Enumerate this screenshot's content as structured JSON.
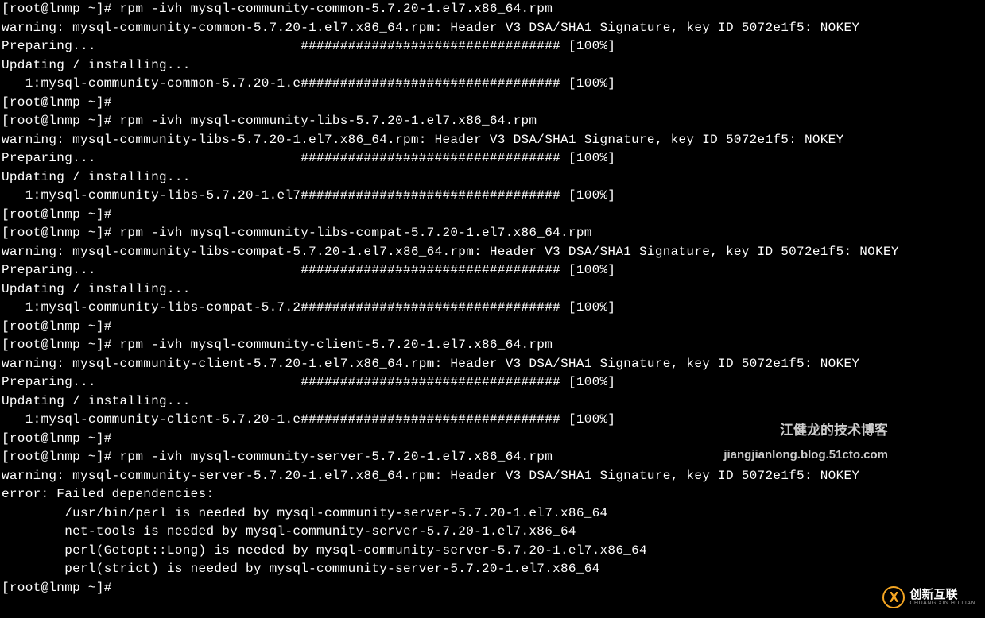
{
  "terminal": {
    "lines": [
      "[root@lnmp ~]# rpm -ivh mysql-community-common-5.7.20-1.el7.x86_64.rpm",
      "warning: mysql-community-common-5.7.20-1.el7.x86_64.rpm: Header V3 DSA/SHA1 Signature, key ID 5072e1f5: NOKEY",
      "Preparing...                          ################################# [100%]",
      "Updating / installing...",
      "   1:mysql-community-common-5.7.20-1.e################################# [100%]",
      "[root@lnmp ~]#",
      "[root@lnmp ~]# rpm -ivh mysql-community-libs-5.7.20-1.el7.x86_64.rpm",
      "warning: mysql-community-libs-5.7.20-1.el7.x86_64.rpm: Header V3 DSA/SHA1 Signature, key ID 5072e1f5: NOKEY",
      "Preparing...                          ################################# [100%]",
      "Updating / installing...",
      "   1:mysql-community-libs-5.7.20-1.el7################################# [100%]",
      "[root@lnmp ~]#",
      "[root@lnmp ~]# rpm -ivh mysql-community-libs-compat-5.7.20-1.el7.x86_64.rpm",
      "warning: mysql-community-libs-compat-5.7.20-1.el7.x86_64.rpm: Header V3 DSA/SHA1 Signature, key ID 5072e1f5: NOKEY",
      "Preparing...                          ################################# [100%]",
      "Updating / installing...",
      "   1:mysql-community-libs-compat-5.7.2################################# [100%]",
      "[root@lnmp ~]#",
      "[root@lnmp ~]# rpm -ivh mysql-community-client-5.7.20-1.el7.x86_64.rpm",
      "warning: mysql-community-client-5.7.20-1.el7.x86_64.rpm: Header V3 DSA/SHA1 Signature, key ID 5072e1f5: NOKEY",
      "Preparing...                          ################################# [100%]",
      "Updating / installing...",
      "   1:mysql-community-client-5.7.20-1.e################################# [100%]",
      "[root@lnmp ~]#",
      "[root@lnmp ~]# rpm -ivh mysql-community-server-5.7.20-1.el7.x86_64.rpm",
      "warning: mysql-community-server-5.7.20-1.el7.x86_64.rpm: Header V3 DSA/SHA1 Signature, key ID 5072e1f5: NOKEY",
      "error: Failed dependencies:",
      "        /usr/bin/perl is needed by mysql-community-server-5.7.20-1.el7.x86_64",
      "        net-tools is needed by mysql-community-server-5.7.20-1.el7.x86_64",
      "        perl(Getopt::Long) is needed by mysql-community-server-5.7.20-1.el7.x86_64",
      "        perl(strict) is needed by mysql-community-server-5.7.20-1.el7.x86_64",
      "[root@lnmp ~]#"
    ]
  },
  "watermark": {
    "line1": "江健龙的技术博客",
    "line2": "jiangjianlong.blog.51cto.com"
  },
  "logo": {
    "letter": "X",
    "cn": "创新互联",
    "en": "CHUANG XIN HU LIAN"
  }
}
